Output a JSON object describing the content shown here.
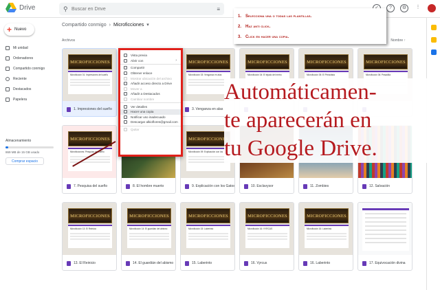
{
  "app": {
    "title": "Drive"
  },
  "search": {
    "placeholder": "Buscar en Drive"
  },
  "sidebar": {
    "new_label": "Nuevo",
    "items": [
      {
        "label": "Mi unidad"
      },
      {
        "label": "Ordenadores"
      },
      {
        "label": "Compartido conmigo"
      },
      {
        "label": "Reciente"
      },
      {
        "label": "Destacados"
      },
      {
        "label": "Papelera"
      }
    ],
    "storage": {
      "label": "Almacenamiento",
      "used_text": "869 MB de 15 GB usado",
      "used_fraction": 0.06,
      "buy_label": "Comprar espacio"
    }
  },
  "breadcrumb": {
    "parent": "Compartido conmigo",
    "current": "Microficciones"
  },
  "section_label": "Archivos",
  "sort_label": "Nombre",
  "thumb_banner": "MICROFICCIONES",
  "files": [
    {
      "name": "1. Impresiones del sueño",
      "subtitle": "Microficción 01: Impresiones del sueño"
    },
    {
      "name": "",
      "subtitle": ""
    },
    {
      "name": "3. Venganza en alas",
      "subtitle": "Microficción 03: Venganza en alas"
    },
    {
      "name": "",
      "subtitle": "Microficción 04: El tejado del metro"
    },
    {
      "name": "",
      "subtitle": "Microficción 05: El Periodista"
    },
    {
      "name": "",
      "subtitle": "Microficción 06: Pesadilla"
    },
    {
      "name": "7. Pesquisa del sueño",
      "subtitle": "Microficciones: Pesquisa del sueño"
    },
    {
      "name": "8. El hombre muerto",
      "subtitle": ""
    },
    {
      "name": "9. Explicación con los Gatos",
      "subtitle": "Microficción 09: Explicación con los"
    },
    {
      "name": "10. Esclavysor",
      "subtitle": ""
    },
    {
      "name": "11. Zombies",
      "subtitle": ""
    },
    {
      "name": "12. Salvación",
      "subtitle": ""
    },
    {
      "name": "13. El Reinicio",
      "subtitle": "Microficción 13: El Reinicio"
    },
    {
      "name": "14. El guardián del abismo",
      "subtitle": "Microficción 14: El guardián del abismo"
    },
    {
      "name": "15. Laberinto",
      "subtitle": "Microficción 15: Laberinto"
    },
    {
      "name": "16. Vyrcus",
      "subtitle": "Microficción 16: VYRCUS"
    },
    {
      "name": "16. Laberinto",
      "subtitle": "Microficción 16: Laberinto"
    },
    {
      "name": "17. Equivocación divina",
      "subtitle": "Microficción 17: Equivocación divina"
    }
  ],
  "menu": [
    {
      "label": "Vista previa"
    },
    {
      "label": "Abrir con"
    },
    {
      "label": "Compartir"
    },
    {
      "label": "Obtener enlace"
    },
    {
      "label": "Mostrar ubicación del archivo"
    },
    {
      "label": "Añadir acceso directo a Drive"
    },
    {
      "label": "Mover a"
    },
    {
      "label": "Añadir a Destacados"
    },
    {
      "label": "Cambiar nombre"
    },
    {
      "label": "Ver detalles"
    },
    {
      "label": "Hacer una copia"
    },
    {
      "label": "Notificar uso inadecuado"
    },
    {
      "label": "Descargar alkioflores@gmail.com"
    },
    {
      "label": "Quitar"
    }
  ],
  "instructions": [
    {
      "num": "1.",
      "text": "Selecciona una o todas las plantillas."
    },
    {
      "num": "2.",
      "text": "Haz anti click."
    },
    {
      "num": "3.",
      "text": "Click en hacer una copia."
    }
  ],
  "overlay": {
    "lines": [
      "Automáticamen-",
      "te aparecerán en",
      "tu Google Drive."
    ]
  },
  "colors": {
    "accent": "#1a73e8",
    "forms": "#673ab7",
    "callout": "#e0201a",
    "overlay_text": "#b51a1f"
  }
}
